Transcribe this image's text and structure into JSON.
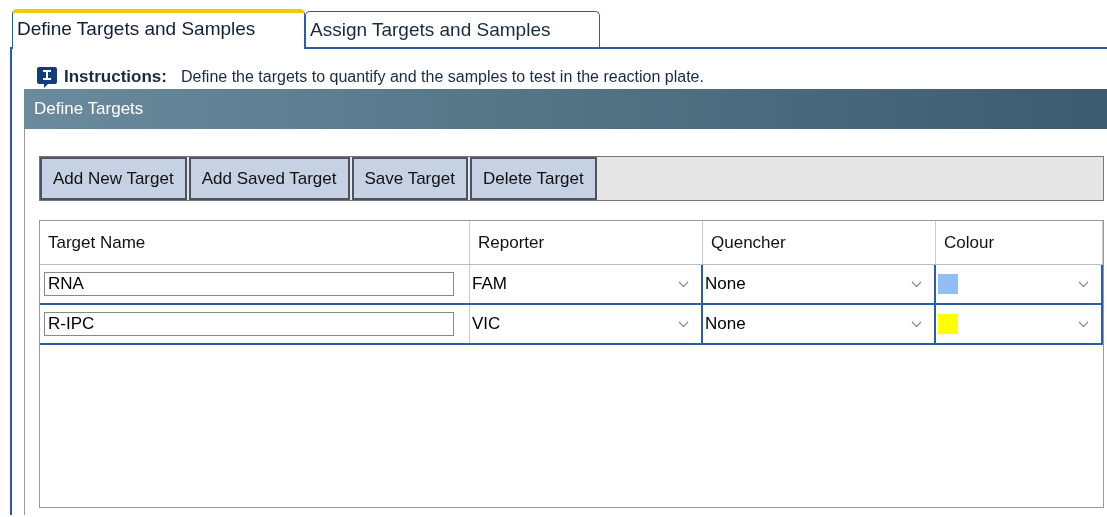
{
  "tabs": [
    {
      "label": "Define Targets and Samples",
      "selected": true
    },
    {
      "label": "Assign Targets and Samples",
      "selected": false
    }
  ],
  "instructions": {
    "label": "Instructions:",
    "text": "Define the targets to quantify and the samples to test in the reaction plate."
  },
  "panel": {
    "title": "Define Targets"
  },
  "buttons": [
    "Add New Target",
    "Add Saved Target",
    "Save Target",
    "Delete Target"
  ],
  "table": {
    "columns": [
      "Target Name",
      "Reporter",
      "Quencher",
      "Colour"
    ],
    "rows": [
      {
        "name": "RNA",
        "reporter": "FAM",
        "quencher": "None",
        "color": "#92bef6"
      },
      {
        "name": "R-IPC",
        "reporter": "VIC",
        "quencher": "None",
        "color": "#ffff00"
      }
    ]
  }
}
